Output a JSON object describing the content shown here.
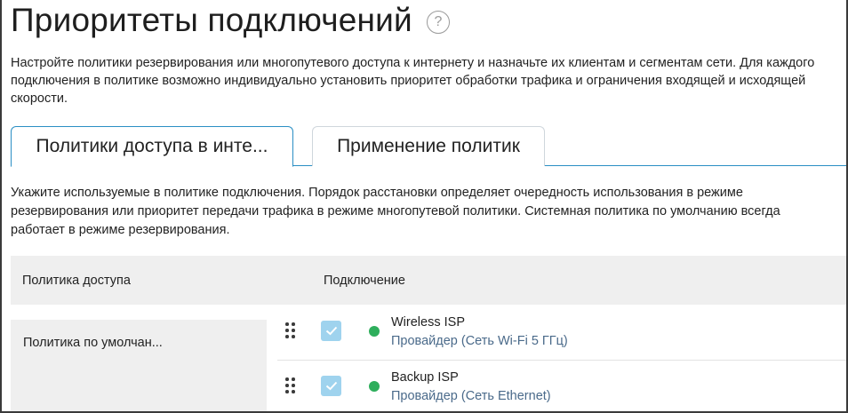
{
  "header": {
    "title": "Приоритеты подключений",
    "help_icon": "question-circle-icon"
  },
  "intro_text": "Настройте политики резервирования или многопутевого доступа к интернету и назначьте их клиентам и сегментам сети. Для каждого подключения в политике возможно индивидуально установить приоритет обработки трафика и ограничения входящей и исходящей скорости.",
  "tabs": [
    {
      "label": "Политики доступа в инте...",
      "active": true
    },
    {
      "label": "Применение политик",
      "active": false
    }
  ],
  "tab_description": "Укажите используемые в политике подключения. Порядок расстановки определяет очередность использования в режиме резервирования или приоритет передачи трафика в режиме многопутевой политики. Системная политика по умолчанию всегда работает в режиме резервирования.",
  "table": {
    "columns": [
      "Политика доступа",
      "Подключение"
    ],
    "policy_name": "Политика по умолчан...",
    "connections": [
      {
        "name": "Wireless ISP",
        "type": "Провайдер (Сеть Wi-Fi 5 ГГц)",
        "enabled": true,
        "status": "connected"
      },
      {
        "name": "Backup ISP",
        "type": "Провайдер (Сеть Ethernet)",
        "enabled": true,
        "status": "connected"
      }
    ]
  },
  "colors": {
    "accent": "#2a8fc4",
    "checkbox_fill": "#9fd3ee",
    "status_ok": "#2eae5c",
    "subtext": "#4a6a8a",
    "header_bg": "#efefef"
  }
}
